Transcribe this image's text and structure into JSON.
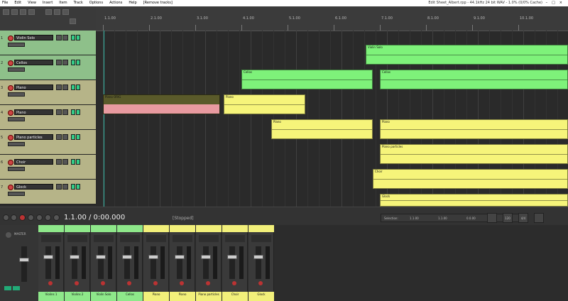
{
  "menu": {
    "items": [
      "File",
      "Edit",
      "View",
      "Insert",
      "Item",
      "Track",
      "Options",
      "Actions",
      "Help",
      "[Remove tracks]"
    ],
    "window_title": "Edit Sheet_Albert.rpp - 44.1kHz 24 bit WAV - 1.0% (0/0% Cache)",
    "window_controls": "–□×"
  },
  "ruler": {
    "markers": [
      {
        "label": "1.1.00"
      },
      {
        "label": "2.1.00"
      },
      {
        "label": "3.1.00"
      },
      {
        "label": "4.1.00"
      },
      {
        "label": "5.1.00"
      },
      {
        "label": "6.1.00"
      },
      {
        "label": "7.1.00"
      },
      {
        "label": "8.1.00"
      },
      {
        "label": "9.1.00"
      },
      {
        "label": "10.1.00"
      }
    ]
  },
  "tracks": [
    {
      "num": "1",
      "name": "Violin Solo",
      "color": "#8ec08a"
    },
    {
      "num": "2",
      "name": "Cellos",
      "color": "#8ec08a"
    },
    {
      "num": "3",
      "name": "Piano",
      "color": "#b6b488"
    },
    {
      "num": "4",
      "name": "Piano",
      "color": "#b6b488"
    },
    {
      "num": "5",
      "name": "Piano particles",
      "color": "#b6b488"
    },
    {
      "num": "6",
      "name": "Choir",
      "color": "#b6b488"
    },
    {
      "num": "7",
      "name": "Glock",
      "color": "#b6b488"
    }
  ],
  "items": [
    {
      "track": 0,
      "name": "Violin Solo",
      "color": "#7ef27a"
    },
    {
      "track": 1,
      "name": "Cellos",
      "color": "#7ef27a"
    },
    {
      "track": 1,
      "name": "Cellos",
      "color": "#7ef27a"
    },
    {
      "track": 2,
      "name": "Piano ORIG",
      "color": "#5a5a2a"
    },
    {
      "track": 2,
      "name": "Piano",
      "color": "#f6f47a"
    },
    {
      "track": 3,
      "name": "Piano",
      "color": "#f6f47a"
    },
    {
      "track": 3,
      "name": "Piano",
      "color": "#f6f47a"
    },
    {
      "track": 4,
      "name": "Piano particles",
      "color": "#f6f47a"
    },
    {
      "track": 5,
      "name": "Choir",
      "color": "#f6f47a"
    },
    {
      "track": 6,
      "name": "Glock",
      "color": "#f6f47a"
    }
  ],
  "transport": {
    "time": "1.1.00 / 0:00.000",
    "state": "[Stopped]",
    "selection_label": "Selection:",
    "sel_start": "1.1.00",
    "sel_end": "1.1.00",
    "sel_len": "0.0.00",
    "bpm": "120",
    "timesig": "4/4"
  },
  "mixer": {
    "master_label": "MASTER",
    "channels": [
      {
        "label": "Violins 1",
        "color": "#8ee88a"
      },
      {
        "label": "Violins 2",
        "color": "#8ee88a"
      },
      {
        "label": "Violin Solo",
        "color": "#8ee88a"
      },
      {
        "label": "Cellos",
        "color": "#8ee88a"
      },
      {
        "label": "Piano",
        "color": "#f2f07a"
      },
      {
        "label": "Piano",
        "color": "#f2f07a"
      },
      {
        "label": "Piano particles",
        "color": "#f2f07a"
      },
      {
        "label": "Choir",
        "color": "#f2f07a"
      },
      {
        "label": "Glock",
        "color": "#f2f07a"
      }
    ]
  }
}
